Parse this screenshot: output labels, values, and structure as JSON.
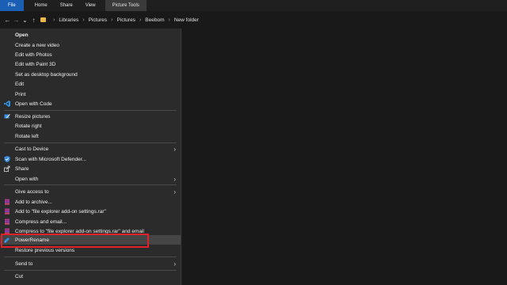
{
  "ribbon": {
    "tabs": [
      "File",
      "Home",
      "Share",
      "View",
      "Picture Tools"
    ]
  },
  "address": {
    "back": "←",
    "forward": "→",
    "recent": "⌄",
    "up": "↑",
    "crumbs": [
      "Libraries",
      "Pictures",
      "Pictures",
      "Beebom",
      "New folder"
    ],
    "separator": "›"
  },
  "menu": {
    "open": "Open",
    "create_video": "Create a new video",
    "edit_photos": "Edit with Photos",
    "edit_paint3d": "Edit with Paint 3D",
    "set_background": "Set as desktop background",
    "edit": "Edit",
    "print": "Print",
    "open_code": "Open with Code",
    "resize": "Resize pictures",
    "rotate_right": "Rotate right",
    "rotate_left": "Rotate left",
    "cast": "Cast to Device",
    "scan": "Scan with Microsoft Defender...",
    "share": "Share",
    "open_with": "Open with",
    "give_access": "Give access to",
    "add_archive": "Add to archive...",
    "add_rar": "Add to \"file explorer add-on settings.rar\"",
    "compress_email": "Compress and email...",
    "compress_rar_email": "Compress to \"file explorer add-on settings.rar\" and email",
    "powerrename": "PowerRename",
    "restore": "Restore previous versions",
    "send_to": "Send to",
    "cut": "Cut",
    "submenu_arrow": "›"
  },
  "colors": {
    "highlight_box": "#e0212a",
    "file_tab": "#1a5fb4",
    "menu_bg": "#2b2b2b"
  }
}
